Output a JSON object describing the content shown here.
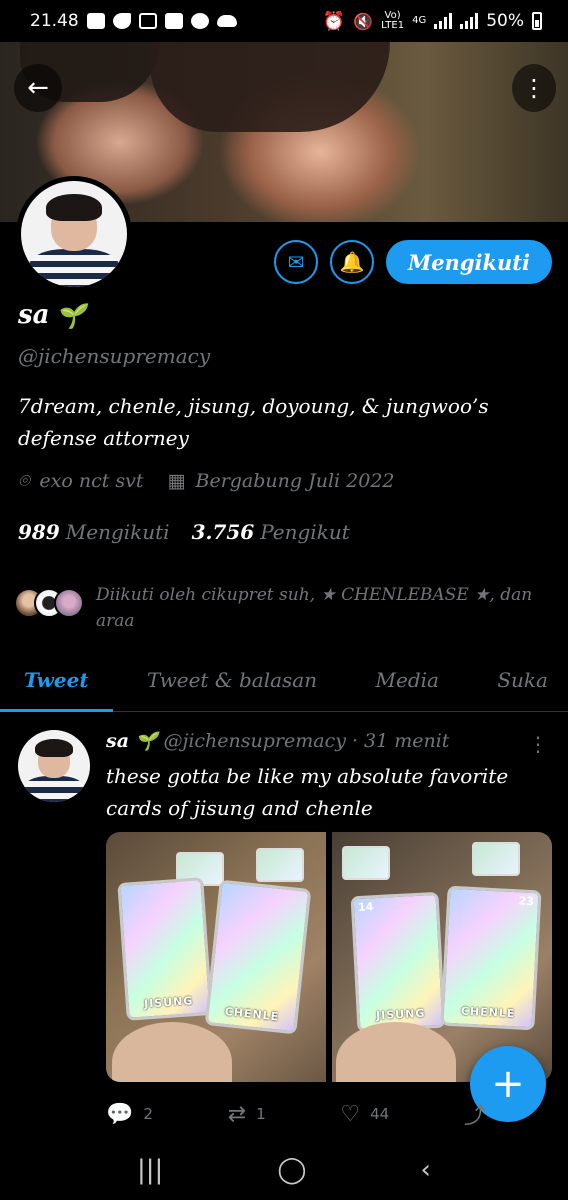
{
  "status_bar": {
    "time": "21.48",
    "network_top": "Vo)",
    "network_bottom": "LTE1",
    "signal_gen": "4G",
    "battery": "50%"
  },
  "header": {
    "back_icon": "arrow-left-icon",
    "more_icon": "more-vertical-icon"
  },
  "profile": {
    "name": "sa",
    "name_emoji": "🌱",
    "handle": "@jichensupremacy",
    "bio": "7dream, chenle, jisung, doyoung, & jungwoo’s defense attorney",
    "location": "exo nct svt",
    "joined": "Bergabung Juli 2022",
    "following_count": "989",
    "following_label": "Mengikuti",
    "followers_count": "3.756",
    "followers_label": "Pengikut",
    "followed_by_text": "Diikuti oleh cikupret suh, ★ CHENLEBASE ★, dan araa",
    "follow_button": "Mengikuti"
  },
  "tabs": [
    {
      "label": "Tweet",
      "active": true
    },
    {
      "label": "Tweet & balasan",
      "active": false
    },
    {
      "label": "Media",
      "active": false
    },
    {
      "label": "Suka",
      "active": false
    }
  ],
  "tweet": {
    "name": "sa",
    "name_emoji": "🌱",
    "handle": "@jichensupremacy",
    "time": "31 menit",
    "text": "these gotta be like my absolute favorite cards of jisung and chenle",
    "card1_label": "JISUNG",
    "card2_label": "CHENLE",
    "card3_label": "JISUNG",
    "card4_label": "CHENLE",
    "card3_number": "14",
    "card4_number": "23",
    "replies": "2",
    "retweets": "1",
    "likes": "44"
  },
  "colors": {
    "accent": "#1d9bf0",
    "background": "#000000",
    "muted_text": "#71767b"
  }
}
